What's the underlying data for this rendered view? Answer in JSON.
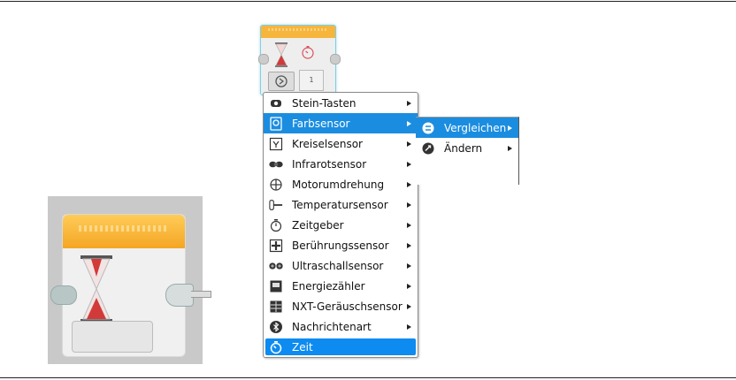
{
  "menu": {
    "items": [
      {
        "label": "Stein-Tasten",
        "icon": "brick-buttons-icon",
        "has_submenu": true
      },
      {
        "label": "Farbsensor",
        "icon": "color-sensor-icon",
        "has_submenu": true,
        "highlighted": true
      },
      {
        "label": "Kreiselsensor",
        "icon": "gyro-sensor-icon",
        "has_submenu": true
      },
      {
        "label": "Infrarotsensor",
        "icon": "infrared-sensor-icon",
        "has_submenu": true
      },
      {
        "label": "Motorumdrehung",
        "icon": "motor-rotation-icon",
        "has_submenu": true
      },
      {
        "label": "Temperatursensor",
        "icon": "temperature-sensor-icon",
        "has_submenu": true
      },
      {
        "label": "Zeitgeber",
        "icon": "timer-icon",
        "has_submenu": true
      },
      {
        "label": "Berührungssensor",
        "icon": "touch-sensor-icon",
        "has_submenu": true
      },
      {
        "label": "Ultraschallsensor",
        "icon": "ultrasonic-sensor-icon",
        "has_submenu": true
      },
      {
        "label": "Energiezähler",
        "icon": "energy-meter-icon",
        "has_submenu": true
      },
      {
        "label": "NXT-Geräuschsensor",
        "icon": "sound-sensor-icon",
        "has_submenu": true
      },
      {
        "label": "Nachrichtenart",
        "icon": "bluetooth-message-icon",
        "has_submenu": true
      },
      {
        "label": "Zeit",
        "icon": "time-icon",
        "has_submenu": false,
        "selected": true
      }
    ]
  },
  "submenu": {
    "items": [
      {
        "label": "Vergleichen",
        "icon": "compare-icon",
        "highlighted": true
      },
      {
        "label": "Ändern",
        "icon": "change-icon"
      }
    ]
  },
  "mini_block": {
    "param_value": "1"
  },
  "colors": {
    "highlight": "#1b8de0",
    "block_header": "#f6b53d",
    "block_body": "#eeeeee",
    "hourglass_sand": "#d23a3a"
  }
}
